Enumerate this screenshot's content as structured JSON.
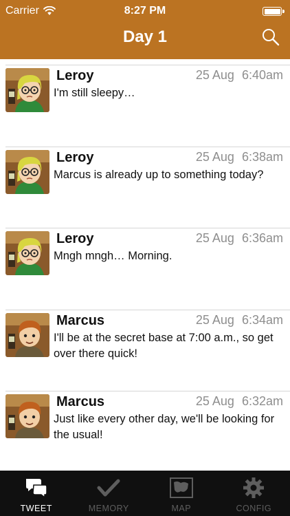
{
  "status_bar": {
    "carrier": "Carrier",
    "time": "8:27 PM"
  },
  "nav": {
    "title": "Day 1"
  },
  "tweets": [
    {
      "author": "Leroy",
      "date": "25 Aug",
      "time": "6:40am",
      "text": "I'm still sleepy…",
      "avatar": "leroy"
    },
    {
      "author": "Leroy",
      "date": "25 Aug",
      "time": "6:38am",
      "text": "Marcus is already up to something today?",
      "avatar": "leroy"
    },
    {
      "author": "Leroy",
      "date": "25 Aug",
      "time": "6:36am",
      "text": "Mngh mngh… Morning.",
      "avatar": "leroy"
    },
    {
      "author": "Marcus",
      "date": "25 Aug",
      "time": "6:34am",
      "text": "I'll be at the secret base at 7:00 a.m., so get over there quick!",
      "avatar": "marcus"
    },
    {
      "author": "Marcus",
      "date": "25 Aug",
      "time": "6:32am",
      "text": "Just like every other day, we'll be looking for the usual!",
      "avatar": "marcus"
    }
  ],
  "tabbar": {
    "tabs": [
      {
        "label": "TWEET",
        "icon": "speech-bubbles-icon",
        "active": true
      },
      {
        "label": "MEMORY",
        "icon": "checkmark-icon",
        "active": false
      },
      {
        "label": "MAP",
        "icon": "map-icon",
        "active": false
      },
      {
        "label": "CONFIG",
        "icon": "gear-icon",
        "active": false
      }
    ]
  },
  "colors": {
    "header": "#bb7322",
    "tabbar": "#101010",
    "tab_active": "#ffffff",
    "tab_inactive": "#5e5e5e",
    "timestamp": "#8e8e8e"
  }
}
